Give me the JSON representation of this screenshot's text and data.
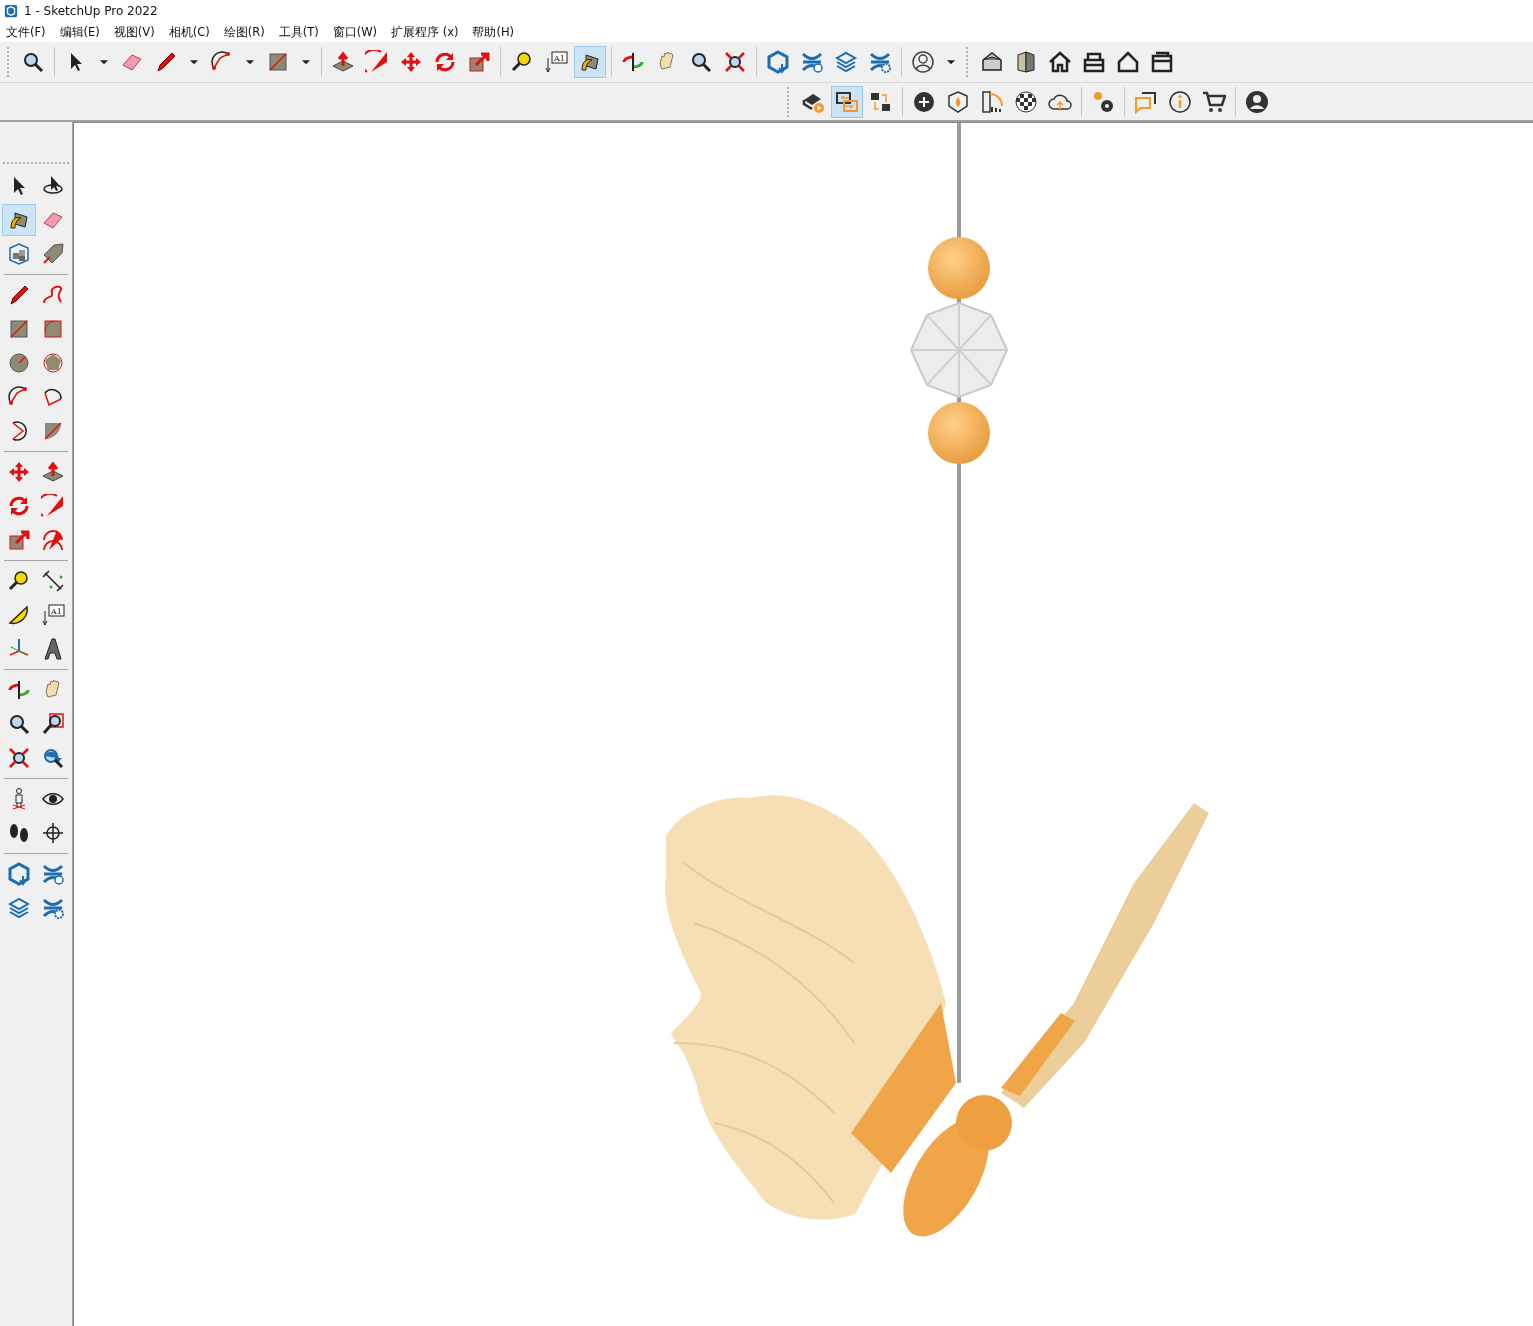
{
  "window": {
    "title": "1 - SketchUp Pro 2022"
  },
  "menu": [
    "文件(F)",
    "编辑(E)",
    "视图(V)",
    "相机(C)",
    "绘图(R)",
    "工具(T)",
    "窗口(W)",
    "扩展程序 (x)",
    "帮助(H)"
  ],
  "main_toolbar": [
    [
      {
        "kind": "zoom",
        "selected": false
      }
    ],
    [
      {
        "kind": "select",
        "selected": false
      },
      {
        "kind": "caret",
        "selected": false
      },
      {
        "kind": "eraser",
        "selected": false
      },
      {
        "kind": "pencil",
        "selected": false
      },
      {
        "kind": "caret",
        "selected": false
      },
      {
        "kind": "arc",
        "selected": false
      },
      {
        "kind": "caret",
        "selected": false
      },
      {
        "kind": "rectangle",
        "selected": false
      },
      {
        "kind": "caret",
        "selected": false
      }
    ],
    [
      {
        "kind": "pushpull",
        "selected": false
      },
      {
        "kind": "followme",
        "selected": false
      },
      {
        "kind": "move",
        "selected": false
      },
      {
        "kind": "rotate",
        "selected": false
      },
      {
        "kind": "scale",
        "selected": false
      }
    ],
    [
      {
        "kind": "tape",
        "selected": false
      },
      {
        "kind": "text",
        "label": "A1",
        "selected": false
      },
      {
        "kind": "paint",
        "selected": true
      }
    ],
    [
      {
        "kind": "orbit",
        "selected": false
      },
      {
        "kind": "pan",
        "selected": false
      },
      {
        "kind": "zoom",
        "selected": false
      },
      {
        "kind": "zoomext",
        "selected": false
      }
    ],
    [
      {
        "kind": "warehouse",
        "selected": false
      },
      {
        "kind": "extsync",
        "selected": false
      },
      {
        "kind": "layers",
        "selected": false
      },
      {
        "kind": "extsettings",
        "selected": false
      }
    ],
    [
      {
        "kind": "user",
        "selected": false
      },
      {
        "kind": "caret",
        "selected": false
      }
    ],
    [
      {
        "kind": "house",
        "selected": false
      },
      {
        "kind": "sideview",
        "selected": false
      },
      {
        "kind": "home",
        "selected": false
      },
      {
        "kind": "topview",
        "selected": false
      },
      {
        "kind": "houseoutline",
        "selected": false
      },
      {
        "kind": "box",
        "selected": false
      }
    ]
  ],
  "secondary_toolbar": [
    [
      {
        "kind": "render",
        "selected": false
      },
      {
        "kind": "swap",
        "selected": true
      },
      {
        "kind": "camswap",
        "selected": false
      }
    ],
    [
      {
        "kind": "plus",
        "selected": false
      },
      {
        "kind": "shield",
        "selected": false
      },
      {
        "kind": "chart",
        "selected": false
      },
      {
        "kind": "checker",
        "selected": false
      },
      {
        "kind": "cloud",
        "selected": false
      }
    ],
    [
      {
        "kind": "gears",
        "selected": false
      }
    ],
    [
      {
        "kind": "chat",
        "selected": false
      },
      {
        "kind": "info",
        "selected": false
      },
      {
        "kind": "cart",
        "selected": false
      }
    ],
    [
      {
        "kind": "profile",
        "selected": false
      }
    ]
  ],
  "side_toolbar": [
    [
      {
        "kind": "select",
        "selected": false
      },
      {
        "kind": "orbitselect",
        "selected": false
      },
      {
        "kind": "paint",
        "selected": true
      },
      {
        "kind": "eraser",
        "selected": false
      },
      {
        "kind": "component",
        "selected": false
      },
      {
        "kind": "tag",
        "selected": false
      }
    ],
    [
      {
        "kind": "pencil",
        "selected": false
      },
      {
        "kind": "freehand",
        "selected": false
      },
      {
        "kind": "rectangle",
        "selected": false
      },
      {
        "kind": "rotrect",
        "selected": false
      },
      {
        "kind": "circle",
        "selected": false
      },
      {
        "kind": "polygon",
        "selected": false
      },
      {
        "kind": "arc",
        "selected": false
      },
      {
        "kind": "arc2",
        "selected": false
      },
      {
        "kind": "arc3",
        "selected": false
      },
      {
        "kind": "pie",
        "selected": false
      }
    ],
    [
      {
        "kind": "move",
        "selected": false
      },
      {
        "kind": "pushpull",
        "selected": false
      },
      {
        "kind": "rotate",
        "selected": false
      },
      {
        "kind": "followme",
        "selected": false
      },
      {
        "kind": "scale",
        "selected": false
      },
      {
        "kind": "offset",
        "selected": false
      }
    ],
    [
      {
        "kind": "tape",
        "selected": false
      },
      {
        "kind": "dimension",
        "selected": false
      },
      {
        "kind": "protractor",
        "selected": false
      },
      {
        "kind": "text",
        "label": "A1",
        "selected": false
      },
      {
        "kind": "axes",
        "selected": false
      },
      {
        "kind": "text3d",
        "selected": false
      }
    ],
    [
      {
        "kind": "orbit",
        "selected": false
      },
      {
        "kind": "pan",
        "selected": false
      },
      {
        "kind": "zoom",
        "selected": false
      },
      {
        "kind": "zoomwin",
        "selected": false
      },
      {
        "kind": "zoomext",
        "selected": false
      },
      {
        "kind": "previous",
        "selected": false
      }
    ],
    [
      {
        "kind": "position",
        "selected": false
      },
      {
        "kind": "look",
        "selected": false
      },
      {
        "kind": "walk",
        "selected": false
      },
      {
        "kind": "section",
        "selected": false
      }
    ],
    [
      {
        "kind": "warehouse",
        "selected": false
      },
      {
        "kind": "extsync",
        "selected": false
      },
      {
        "kind": "layers",
        "selected": false
      },
      {
        "kind": "extsettings",
        "selected": false
      }
    ]
  ]
}
